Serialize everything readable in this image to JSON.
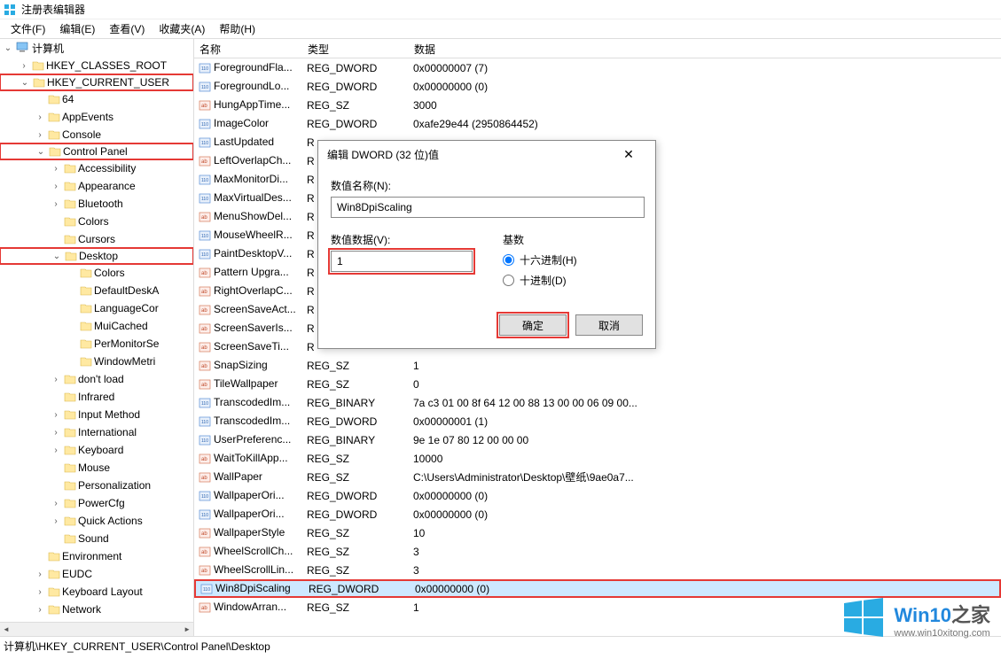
{
  "title": "注册表编辑器",
  "menu": {
    "file": "文件(F)",
    "edit": "编辑(E)",
    "view": "查看(V)",
    "fav": "收藏夹(A)",
    "help": "帮助(H)"
  },
  "tree": {
    "root": "计算机",
    "hives": {
      "hkcr": "HKEY_CLASSES_ROOT",
      "hkcu": "HKEY_CURRENT_USER"
    },
    "hkcu_children": [
      "64",
      "AppEvents",
      "Console",
      "Control Panel"
    ],
    "cp_children": [
      "Accessibility",
      "Appearance",
      "Bluetooth",
      "Colors",
      "Cursors",
      "Desktop"
    ],
    "desktop_children": [
      "Colors",
      "DefaultDeskA",
      "LanguageCor",
      "MuiCached",
      "PerMonitorSe",
      "WindowMetri"
    ],
    "cp_after_desktop": [
      "don't load",
      "Infrared",
      "Input Method",
      "International",
      "Keyboard",
      "Mouse",
      "Personalization",
      "PowerCfg",
      "Quick Actions",
      "Sound"
    ],
    "hkcu_after_cp": [
      "Environment",
      "EUDC",
      "Keyboard Layout",
      "Network"
    ]
  },
  "columns": {
    "name": "名称",
    "type": "类型",
    "data": "数据"
  },
  "rows": [
    {
      "ic": "bin",
      "n": "ForegroundFla...",
      "t": "REG_DWORD",
      "d": "0x00000007 (7)"
    },
    {
      "ic": "bin",
      "n": "ForegroundLo...",
      "t": "REG_DWORD",
      "d": "0x00000000 (0)"
    },
    {
      "ic": "str",
      "n": "HungAppTime...",
      "t": "REG_SZ",
      "d": "3000"
    },
    {
      "ic": "bin",
      "n": "ImageColor",
      "t": "REG_DWORD",
      "d": "0xafe29e44 (2950864452)"
    },
    {
      "ic": "bin",
      "n": "LastUpdated",
      "t": "R",
      "d": ""
    },
    {
      "ic": "str",
      "n": "LeftOverlapCh...",
      "t": "R",
      "d": ""
    },
    {
      "ic": "bin",
      "n": "MaxMonitorDi...",
      "t": "R",
      "d": ""
    },
    {
      "ic": "bin",
      "n": "MaxVirtualDes...",
      "t": "R",
      "d": ""
    },
    {
      "ic": "str",
      "n": "MenuShowDel...",
      "t": "R",
      "d": ""
    },
    {
      "ic": "bin",
      "n": "MouseWheelR...",
      "t": "R",
      "d": ""
    },
    {
      "ic": "bin",
      "n": "PaintDesktopV...",
      "t": "R",
      "d": ""
    },
    {
      "ic": "str",
      "n": "Pattern Upgra...",
      "t": "R",
      "d": ""
    },
    {
      "ic": "str",
      "n": "RightOverlapC...",
      "t": "R",
      "d": ""
    },
    {
      "ic": "str",
      "n": "ScreenSaveAct...",
      "t": "R",
      "d": ""
    },
    {
      "ic": "str",
      "n": "ScreenSaverIs...",
      "t": "R",
      "d": ""
    },
    {
      "ic": "str",
      "n": "ScreenSaveTi...",
      "t": "R",
      "d": ""
    },
    {
      "ic": "str",
      "n": "SnapSizing",
      "t": "REG_SZ",
      "d": "1"
    },
    {
      "ic": "str",
      "n": "TileWallpaper",
      "t": "REG_SZ",
      "d": "0"
    },
    {
      "ic": "bin",
      "n": "TranscodedIm...",
      "t": "REG_BINARY",
      "d": "7a c3 01 00 8f 64 12 00 88 13 00 00 06 09 00..."
    },
    {
      "ic": "bin",
      "n": "TranscodedIm...",
      "t": "REG_DWORD",
      "d": "0x00000001 (1)"
    },
    {
      "ic": "bin",
      "n": "UserPreferenc...",
      "t": "REG_BINARY",
      "d": "9e 1e 07 80 12 00 00 00"
    },
    {
      "ic": "str",
      "n": "WaitToKillApp...",
      "t": "REG_SZ",
      "d": "10000"
    },
    {
      "ic": "str",
      "n": "WallPaper",
      "t": "REG_SZ",
      "d": "C:\\Users\\Administrator\\Desktop\\壁纸\\9ae0a7..."
    },
    {
      "ic": "bin",
      "n": "WallpaperOri...",
      "t": "REG_DWORD",
      "d": "0x00000000 (0)"
    },
    {
      "ic": "bin",
      "n": "WallpaperOri...",
      "t": "REG_DWORD",
      "d": "0x00000000 (0)"
    },
    {
      "ic": "str",
      "n": "WallpaperStyle",
      "t": "REG_SZ",
      "d": "10"
    },
    {
      "ic": "str",
      "n": "WheelScrollCh...",
      "t": "REG_SZ",
      "d": "3"
    },
    {
      "ic": "str",
      "n": "WheelScrollLin...",
      "t": "REG_SZ",
      "d": "3"
    },
    {
      "ic": "bin",
      "n": "Win8DpiScaling",
      "t": "REG_DWORD",
      "d": "0x00000000 (0)",
      "sel": true,
      "hl": true
    },
    {
      "ic": "str",
      "n": "WindowArran...",
      "t": "REG_SZ",
      "d": "1"
    }
  ],
  "dialog": {
    "title": "编辑 DWORD (32 位)值",
    "name_label": "数值名称(N):",
    "name_value": "Win8DpiScaling",
    "data_label": "数值数据(V):",
    "data_value": "1",
    "base_label": "基数",
    "hex": "十六进制(H)",
    "dec": "十进制(D)",
    "ok": "确定",
    "cancel": "取消"
  },
  "status": "计算机\\HKEY_CURRENT_USER\\Control Panel\\Desktop",
  "watermark": {
    "title_en": "Win10",
    "title_zh": "之家",
    "sub": "www.win10xitong.com"
  }
}
